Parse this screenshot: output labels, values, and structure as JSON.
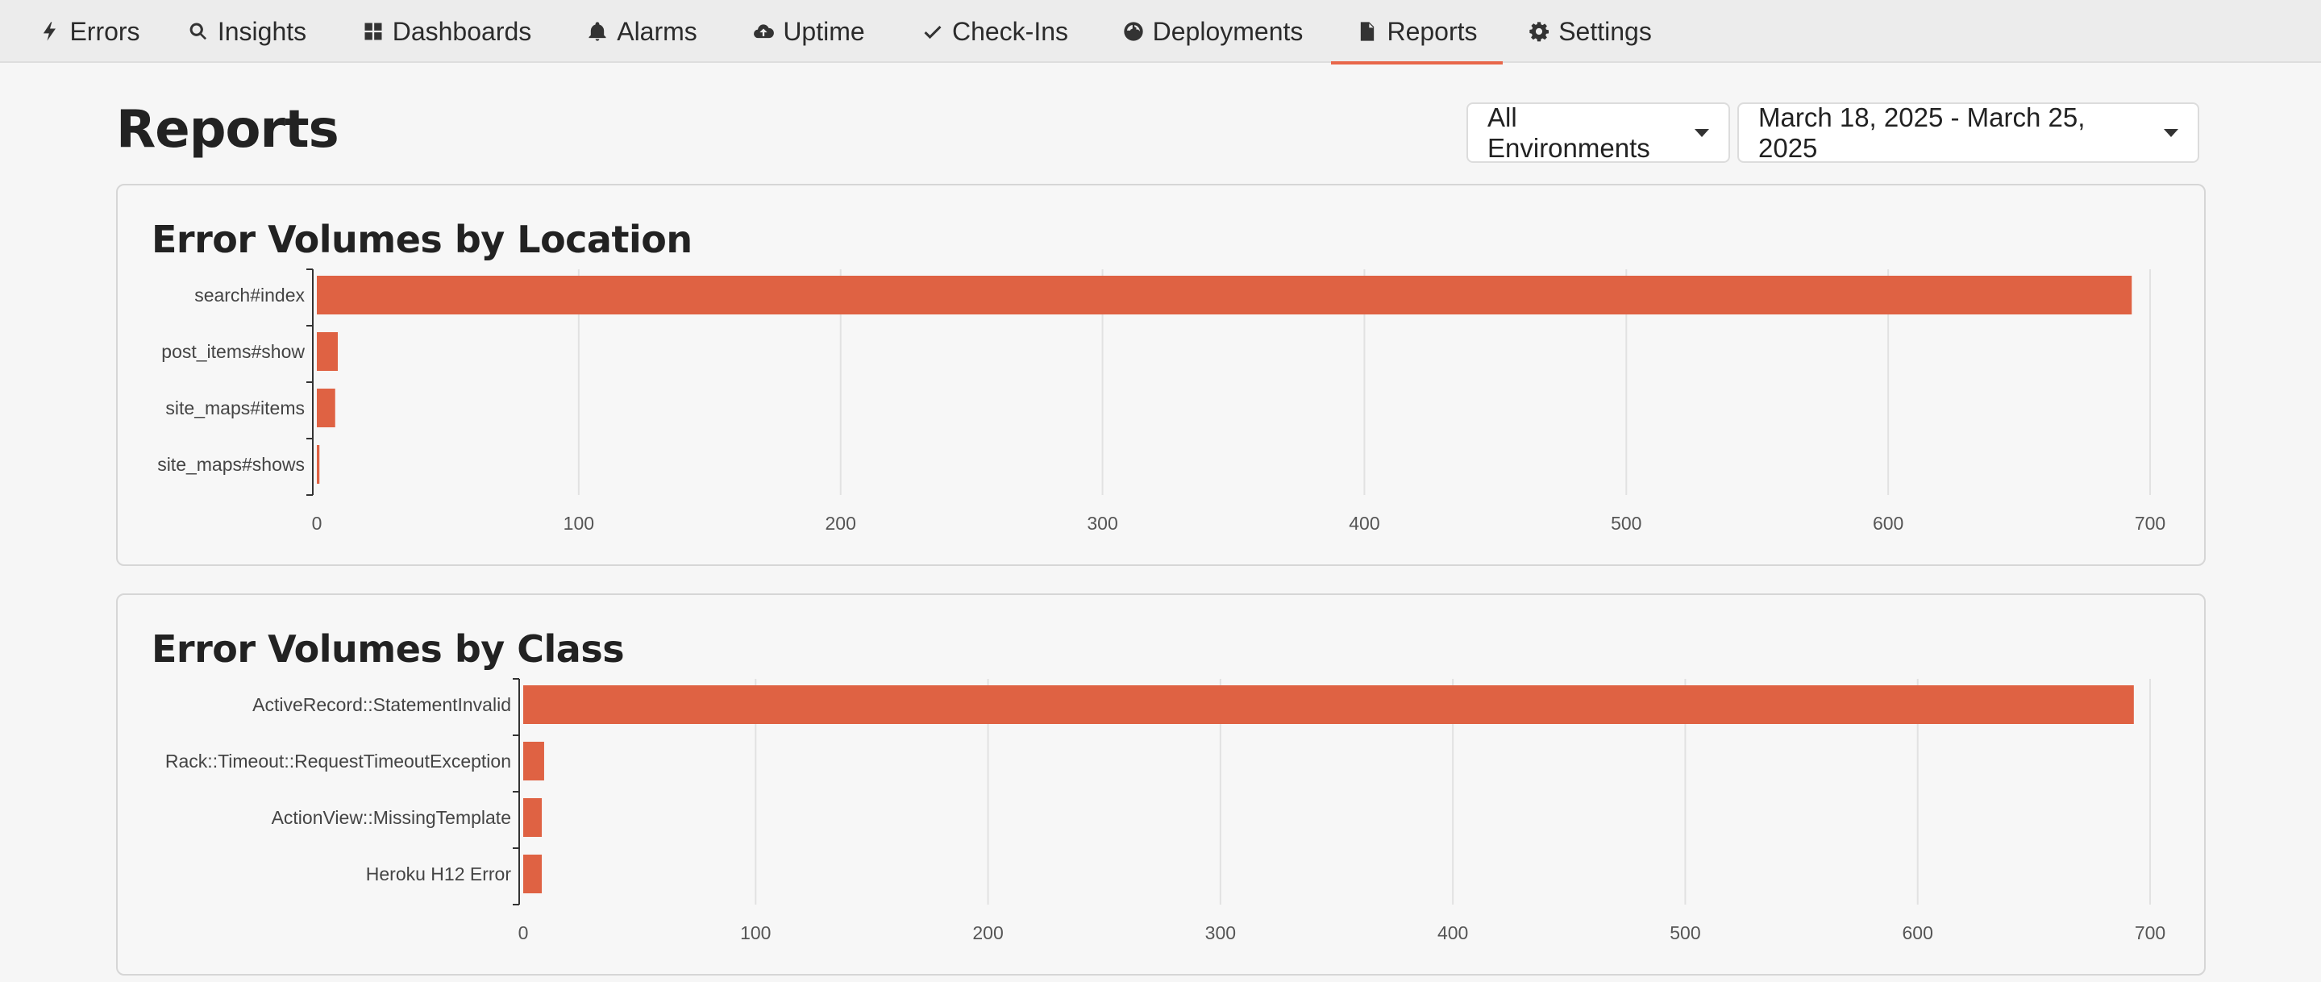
{
  "nav": {
    "items": [
      {
        "label": "Errors",
        "icon": "bolt-icon",
        "active": false
      },
      {
        "label": "Insights",
        "icon": "search-icon",
        "active": false
      },
      {
        "label": "Dashboards",
        "icon": "dashboard-grid-icon",
        "active": false
      },
      {
        "label": "Alarms",
        "icon": "bell-icon",
        "active": false
      },
      {
        "label": "Uptime",
        "icon": "cloud-upload-icon",
        "active": false
      },
      {
        "label": "Check-Ins",
        "icon": "checkmark-icon",
        "active": false
      },
      {
        "label": "Deployments",
        "icon": "globe-icon",
        "active": false
      },
      {
        "label": "Reports",
        "icon": "file-icon",
        "active": true
      },
      {
        "label": "Settings",
        "icon": "gear-icon",
        "active": false
      }
    ],
    "accent_color": "#e8674a"
  },
  "header": {
    "title": "Reports",
    "environment_select": "All Environments",
    "date_range_select": "March 18, 2025 - March 25, 2025"
  },
  "chart_data": [
    {
      "type": "bar",
      "orientation": "horizontal",
      "title": "Error Volumes by Location",
      "categories": [
        "search#index",
        "post_items#show",
        "site_maps#items",
        "site_maps#shows"
      ],
      "values": [
        693,
        8,
        7,
        1
      ],
      "xlim": [
        0,
        700
      ],
      "xticks": [
        0,
        100,
        200,
        300,
        400,
        500,
        600,
        700
      ],
      "grid": true,
      "bar_color": "#df6243"
    },
    {
      "type": "bar",
      "orientation": "horizontal",
      "title": "Error Volumes by Class",
      "categories": [
        "ActiveRecord::StatementInvalid",
        "Rack::Timeout::RequestTimeoutException",
        "ActionView::MissingTemplate",
        "Heroku H12 Error"
      ],
      "values": [
        693,
        9,
        8,
        8
      ],
      "xlim": [
        0,
        700
      ],
      "xticks": [
        0,
        100,
        200,
        300,
        400,
        500,
        600,
        700
      ],
      "grid": true,
      "bar_color": "#df6243"
    }
  ]
}
